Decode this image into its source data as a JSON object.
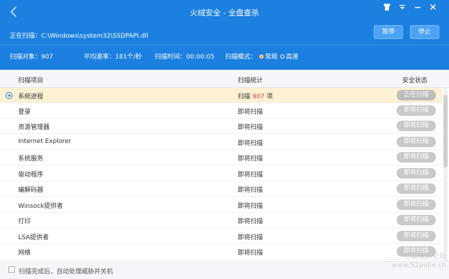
{
  "header": {
    "title": "火绒安全 - 全盘查杀",
    "scan_path": "正在扫描：C:\\Windows\\system32\\SSDPAPI.dll",
    "pause_label": "暂停",
    "stop_label": "停止",
    "status": {
      "objects": "扫描对象：907",
      "speed": "平均速率：181个/秒",
      "time": "扫描时间：00:00:05",
      "mode_label": "扫描模式：",
      "mode_options": [
        "常规",
        "高速"
      ],
      "mode_selected": "常规"
    }
  },
  "columns": {
    "item": "扫描项目",
    "stat": "扫描统计",
    "state": "安全状态"
  },
  "rows": [
    {
      "name": "系统进程",
      "stat_prefix": "扫描",
      "stat_num": "907",
      "stat_suffix": "项",
      "state": "正在扫描",
      "active": true
    },
    {
      "name": "登录",
      "stat": "即将扫描",
      "state": "即将扫描"
    },
    {
      "name": "资源管理器",
      "stat": "即将扫描",
      "state": "即将扫描"
    },
    {
      "name": "Internet Explorer",
      "stat": "即将扫描",
      "state": "即将扫描"
    },
    {
      "name": "系统服务",
      "stat": "即将扫描",
      "state": "即将扫描"
    },
    {
      "name": "驱动程序",
      "stat": "即将扫描",
      "state": "即将扫描"
    },
    {
      "name": "编解码器",
      "stat": "即将扫描",
      "state": "即将扫描"
    },
    {
      "name": "Winsock提供者",
      "stat": "即将扫描",
      "state": "即将扫描"
    },
    {
      "name": "打印",
      "stat": "即将扫描",
      "state": "即将扫描"
    },
    {
      "name": "LSA提供者",
      "stat": "即将扫描",
      "state": "即将扫描"
    },
    {
      "name": "网络",
      "stat": "即将扫描",
      "state": "即将扫描"
    }
  ],
  "footer": {
    "auto_shutdown_label": "扫描完成后，自动处理威胁并关机",
    "auto_shutdown_checked": false
  },
  "watermark": {
    "line1": "吾爱破解论坛",
    "line2": "www.52pojie.cn"
  },
  "icons": {
    "back": "chevron-left-icon",
    "skin": "shirt-icon",
    "menu": "menu-icon",
    "minimize": "minimize-icon",
    "close": "close-icon",
    "current_row": "arrow-circle-icon"
  },
  "colors": {
    "header_bg": "#1b80e0",
    "active_row_bg": "#fcf1d3",
    "count_red": "#e0392b",
    "mode_radio_on": "#ffa54a"
  }
}
